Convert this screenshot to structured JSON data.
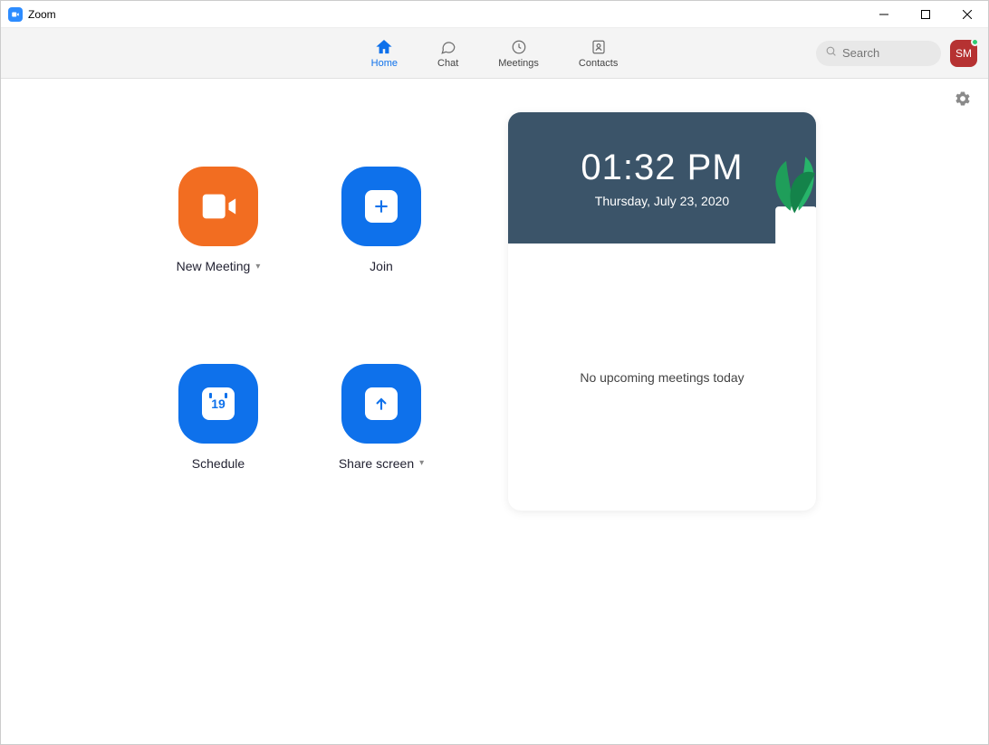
{
  "window": {
    "title": "Zoom"
  },
  "nav": {
    "tabs": [
      {
        "label": "Home",
        "icon": "home-icon",
        "active": true
      },
      {
        "label": "Chat",
        "icon": "chat-icon",
        "active": false
      },
      {
        "label": "Meetings",
        "icon": "clock-icon",
        "active": false
      },
      {
        "label": "Contacts",
        "icon": "contacts-icon",
        "active": false
      }
    ],
    "search_placeholder": "Search",
    "avatar_initials": "SM"
  },
  "actions": {
    "new_meeting": "New Meeting",
    "join": "Join",
    "schedule": "Schedule",
    "schedule_day": "19",
    "share_screen": "Share screen"
  },
  "info": {
    "time": "01:32 PM",
    "date": "Thursday, July 23, 2020",
    "empty_message": "No upcoming meetings today"
  }
}
